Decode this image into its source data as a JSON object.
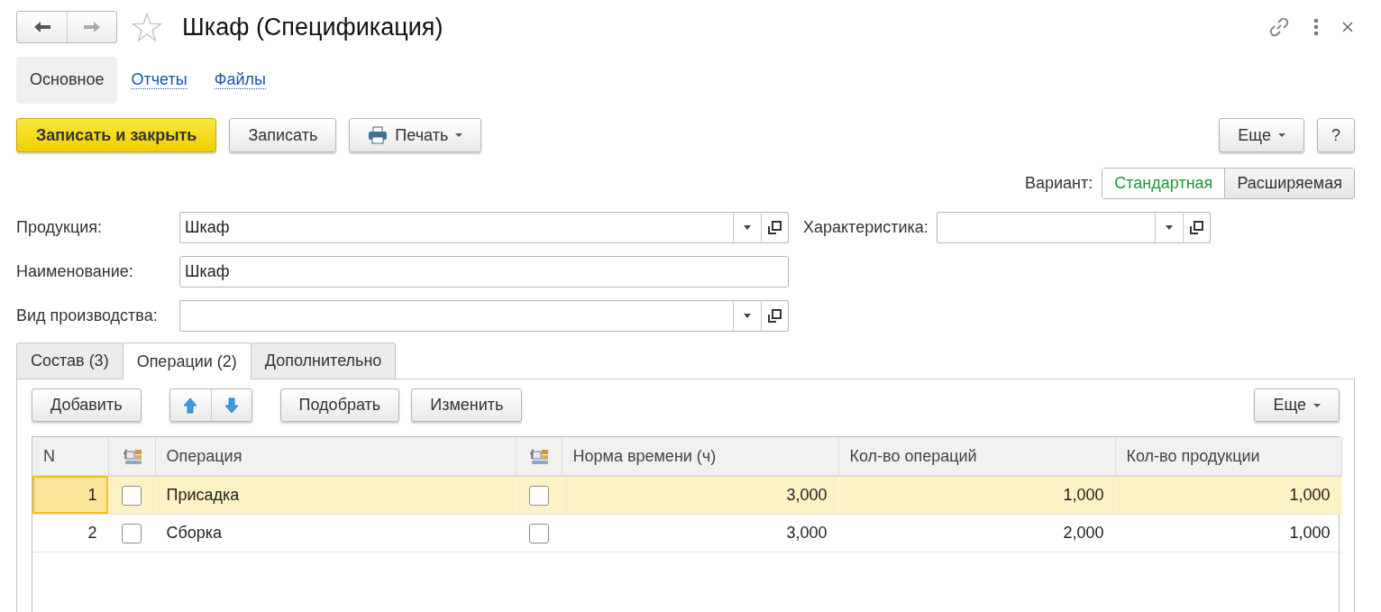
{
  "window": {
    "title": "Шкаф (Спецификация)",
    "favorite": false
  },
  "sections": [
    {
      "label": "Основное",
      "selected": true
    },
    {
      "label": "Отчеты",
      "selected": false
    },
    {
      "label": "Файлы",
      "selected": false
    }
  ],
  "command_bar": {
    "buttons": [
      {
        "label": "Записать и закрыть",
        "kind": "primary"
      },
      {
        "label": "Записать",
        "kind": "plain"
      },
      {
        "label": "Печать",
        "kind": "print"
      }
    ],
    "more": "Еще",
    "help": "?"
  },
  "variant": {
    "label": "Вариант:",
    "options": [
      {
        "label": "Стандартная",
        "selected": true
      },
      {
        "label": "Расширяемая",
        "selected": false
      }
    ]
  },
  "fields": {
    "product": {
      "label": "Продукция:",
      "value": "Шкаф"
    },
    "characteristic": {
      "label": "Характеристика:"
    },
    "name": {
      "label": "Наименование:",
      "value": "Шкаф"
    },
    "production_kind": {
      "label": "Вид производства:"
    }
  },
  "tabs": [
    {
      "label": "Состав (3)",
      "selected": false
    },
    {
      "label": "Операции (2)",
      "selected": true
    },
    {
      "label": "Дополнительно",
      "selected": false
    }
  ],
  "table_toolbar": {
    "add": "Добавить",
    "pick": "Подобрать",
    "edit": "Изменить",
    "more": "Еще"
  },
  "table": {
    "columns": [
      {
        "kind": "text",
        "label": "N"
      },
      {
        "kind": "icon"
      },
      {
        "kind": "text",
        "label": "Операция"
      },
      {
        "kind": "icon"
      },
      {
        "kind": "text",
        "label": "Норма времени (ч)"
      },
      {
        "kind": "text",
        "label": "Кол-во операций"
      },
      {
        "kind": "text",
        "label": "Кол-во продукции"
      }
    ],
    "rows": [
      {
        "selected": true,
        "n": "1",
        "flag_1": false,
        "operation": "Присадка",
        "flag_2": false,
        "time_norm": "3,000",
        "operations_count": "1,000",
        "products_count": "1,000"
      },
      {
        "selected": false,
        "n": "2",
        "flag_1": false,
        "operation": "Сборка",
        "flag_2": false,
        "time_norm": "3,000",
        "operations_count": "2,000",
        "products_count": "1,000"
      }
    ]
  }
}
